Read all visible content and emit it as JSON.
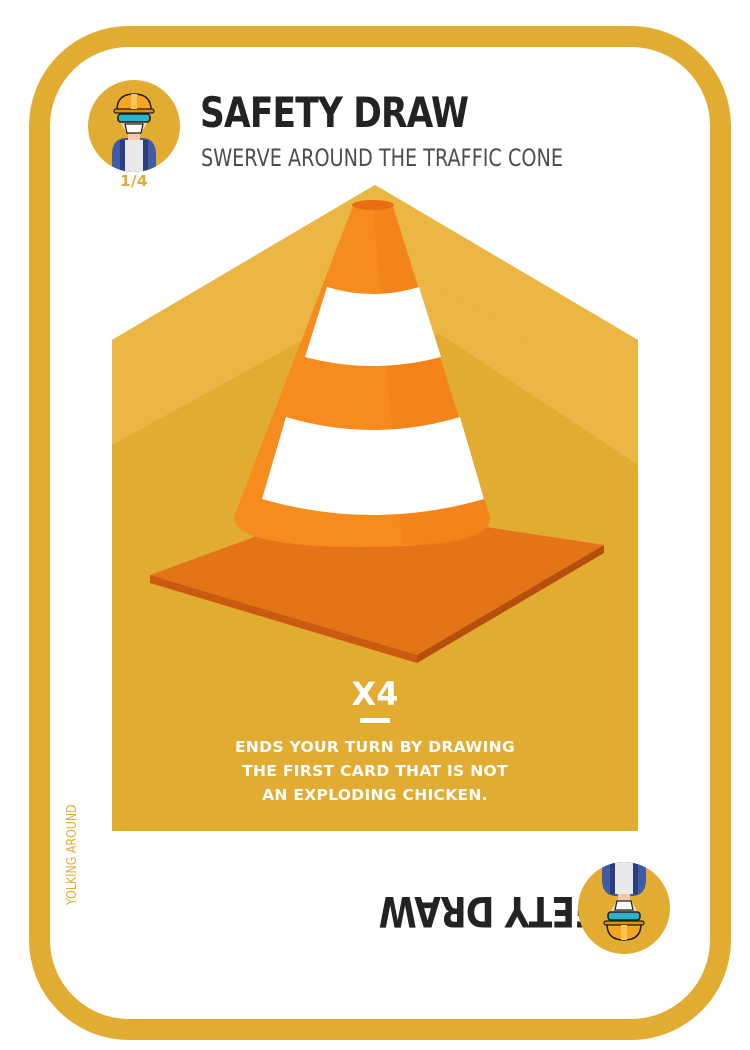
{
  "card": {
    "title": "SAFETY DRAW",
    "subtitle": "SWERVE AROUND THE TRAFFIC CONE",
    "counter": "1/4",
    "multiplier": "X4",
    "rule_lines": [
      "ENDS YOUR TURN BY DRAWING",
      "THE FIRST CARD THAT IS NOT",
      "AN EXPLODING CHICKEN."
    ],
    "title_flipped": "SAFETY DRAW",
    "side_label": "YOLKING AROUND"
  },
  "icons": {
    "badge_top": "construction-worker-icon",
    "badge_bottom": "construction-worker-icon",
    "artwork": "traffic-cone-icon"
  },
  "colors": {
    "frame": "#e2ac32",
    "art_light": "#ebb643",
    "art_dark": "#e2ab32",
    "cone_orange": "#f68b1e",
    "cone_base_dark": "#d86410",
    "title_text": "#232323",
    "subtitle_text": "#4d4d4d"
  }
}
